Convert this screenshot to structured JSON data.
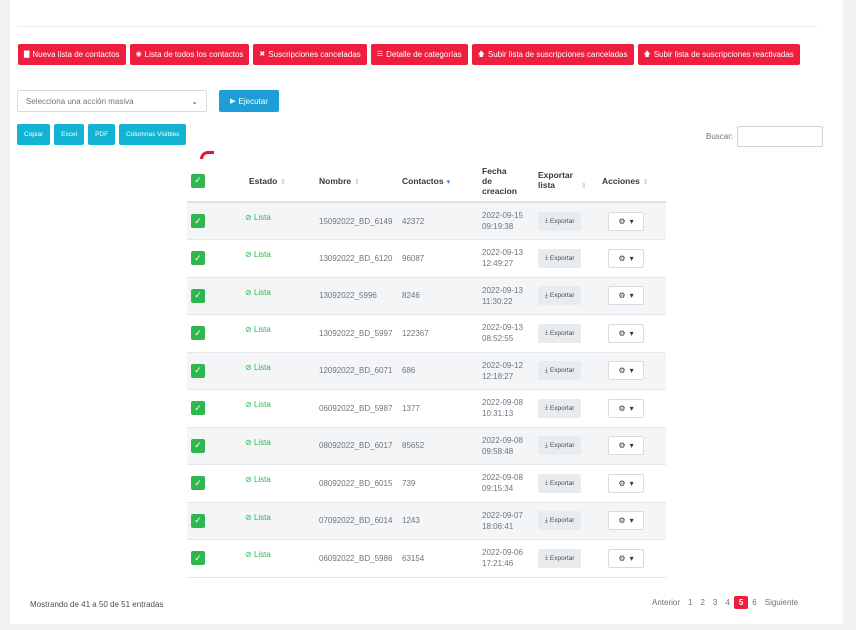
{
  "top_buttons": [
    {
      "icon": "book-icon",
      "glyph": "▇",
      "label": "Nueva lista de contactos"
    },
    {
      "icon": "eye-icon",
      "glyph": "◉",
      "label": "Lista de todos los contactos"
    },
    {
      "icon": "x-icon",
      "glyph": "✖",
      "label": "Suscripciones canceladas"
    },
    {
      "icon": "list-icon",
      "glyph": "☰",
      "label": "Detalle de categorías"
    },
    {
      "icon": "arrow-up-icon",
      "glyph": "🡅",
      "label": "Subir lista de suscripciones canceladas"
    },
    {
      "icon": "arrow-up-icon",
      "glyph": "🡅",
      "label": "Subir lista de suscripciones reactivadas"
    }
  ],
  "mass_action": {
    "placeholder": "Selecciona una acción masiva",
    "execute_label": "Ejecutar"
  },
  "export_buttons": [
    "Copiar",
    "Excel",
    "PDF",
    "Columnas Visibles"
  ],
  "search": {
    "label": "Buscar:",
    "value": ""
  },
  "table": {
    "headers": {
      "estado": "Estado",
      "nombre": "Nombre",
      "contactos": "Contactos",
      "fecha": "Fecha de creacion",
      "exportar": "Exportar lista",
      "acciones": "Acciones"
    },
    "export_label": "Exportar",
    "rows": [
      {
        "estado": "Lista",
        "nombre": "15092022_BD_6149",
        "contactos": "42372",
        "fecha": "2022-09-15",
        "hora": "09:19:38"
      },
      {
        "estado": "Lista",
        "nombre": "13092022_BD_6120",
        "contactos": "96087",
        "fecha": "2022-09-13",
        "hora": "12:49:27"
      },
      {
        "estado": "Lista",
        "nombre": "13092022_5996",
        "contactos": "8246",
        "fecha": "2022-09-13",
        "hora": "11:30:22"
      },
      {
        "estado": "Lista",
        "nombre": "13092022_BD_5997",
        "contactos": "122367",
        "fecha": "2022-09-13",
        "hora": "08:52:55"
      },
      {
        "estado": "Lista",
        "nombre": "12092022_BD_6071",
        "contactos": "686",
        "fecha": "2022-09-12",
        "hora": "12:18:27"
      },
      {
        "estado": "Lista",
        "nombre": "06092022_BD_5987",
        "contactos": "1377",
        "fecha": "2022-09-08",
        "hora": "10:31:13"
      },
      {
        "estado": "Lista",
        "nombre": "08092022_BD_6017",
        "contactos": "85652",
        "fecha": "2022-09-08",
        "hora": "09:58:48"
      },
      {
        "estado": "Lista",
        "nombre": "08092022_BD_6015",
        "contactos": "739",
        "fecha": "2022-09-08",
        "hora": "09:15:34"
      },
      {
        "estado": "Lista",
        "nombre": "07092022_BD_6014",
        "contactos": "1243",
        "fecha": "2022-09-07",
        "hora": "18:06:41"
      },
      {
        "estado": "Lista",
        "nombre": "06092022_BD_5986",
        "contactos": "63154",
        "fecha": "2022-09-06",
        "hora": "17:21:46"
      }
    ]
  },
  "footer": {
    "info": "Mostrando de 41 a 50 de 51 entradas",
    "pager": {
      "prev": "Anterior",
      "pages": [
        "1",
        "2",
        "3",
        "4",
        "5",
        "6"
      ],
      "active": "5",
      "next": "Siguiente"
    }
  },
  "colors": {
    "accent_red": "#ef1d3e",
    "primary_blue": "#1d9ed6",
    "cyan": "#11b4d3",
    "success_green": "#2fb74f"
  }
}
